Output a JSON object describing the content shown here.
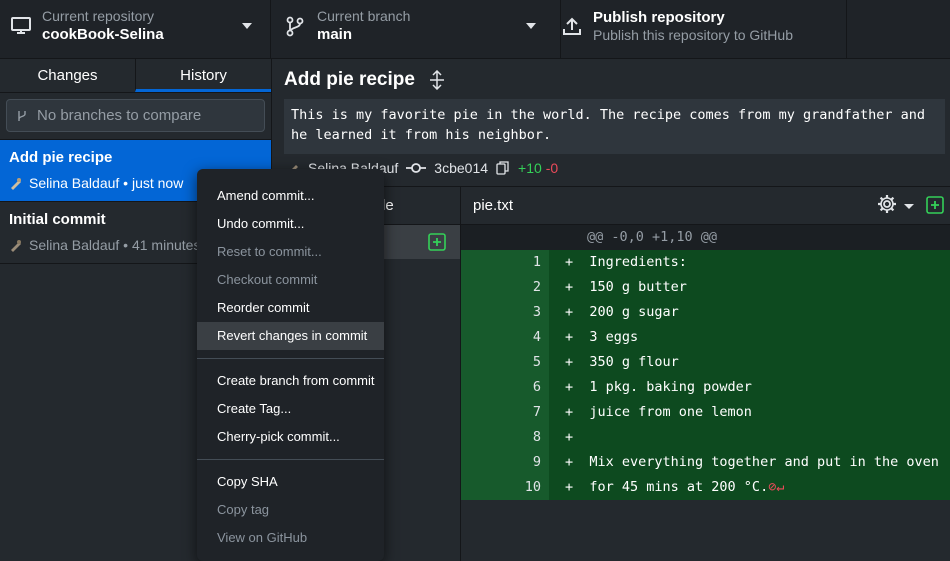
{
  "toolbar": {
    "repo_label": "Current repository",
    "repo_value": "cookBook-Selina",
    "branch_label": "Current branch",
    "branch_value": "main",
    "publish_title": "Publish repository",
    "publish_desc": "Publish this repository to GitHub"
  },
  "sidebar": {
    "tabs": [
      "Changes",
      "History"
    ],
    "compare_placeholder": "No branches to compare",
    "commits": [
      {
        "title": "Add pie recipe",
        "meta": "Selina Baldauf • just now"
      },
      {
        "title": "Initial commit",
        "meta": "Selina Baldauf • 41 minutes"
      }
    ]
  },
  "commit": {
    "title": "Add pie recipe",
    "description": "This is my favorite pie in the world. The recipe comes from my grandfather and he learned it from his neighbor.",
    "author": "Selina Baldauf",
    "sha": "3cbe014",
    "additions": "+10",
    "deletions": "-0"
  },
  "files": {
    "header": "d file"
  },
  "diff": {
    "filename": "pie.txt",
    "hunk": "@@ -0,0 +1,10 @@",
    "lines": [
      {
        "num": "1",
        "text": "+  Ingredients:"
      },
      {
        "num": "2",
        "text": "+  150 g butter"
      },
      {
        "num": "3",
        "text": "+  200 g sugar"
      },
      {
        "num": "4",
        "text": "+  3 eggs"
      },
      {
        "num": "5",
        "text": "+  350 g flour"
      },
      {
        "num": "6",
        "text": "+  1 pkg. baking powder"
      },
      {
        "num": "7",
        "text": "+  juice from one lemon"
      },
      {
        "num": "8",
        "text": "+"
      },
      {
        "num": "9",
        "text": "+  Mix everything together and put in the oven"
      },
      {
        "num": "10",
        "text": "+  for 45 mins at 200 °C."
      }
    ],
    "no_newline_marker": "⊘↵"
  },
  "context_menu": {
    "group1": [
      {
        "label": "Amend commit...",
        "disabled": false
      },
      {
        "label": "Undo commit...",
        "disabled": false
      },
      {
        "label": "Reset to commit...",
        "disabled": true
      },
      {
        "label": "Checkout commit",
        "disabled": true
      },
      {
        "label": "Reorder commit",
        "disabled": false
      },
      {
        "label": "Revert changes in commit",
        "disabled": false
      }
    ],
    "group2": [
      {
        "label": "Create branch from commit",
        "disabled": false
      },
      {
        "label": "Create Tag...",
        "disabled": false
      },
      {
        "label": "Cherry-pick commit...",
        "disabled": false
      }
    ],
    "group3": [
      {
        "label": "Copy SHA",
        "disabled": false
      },
      {
        "label": "Copy tag",
        "disabled": true
      },
      {
        "label": "View on GitHub",
        "disabled": true
      }
    ]
  }
}
